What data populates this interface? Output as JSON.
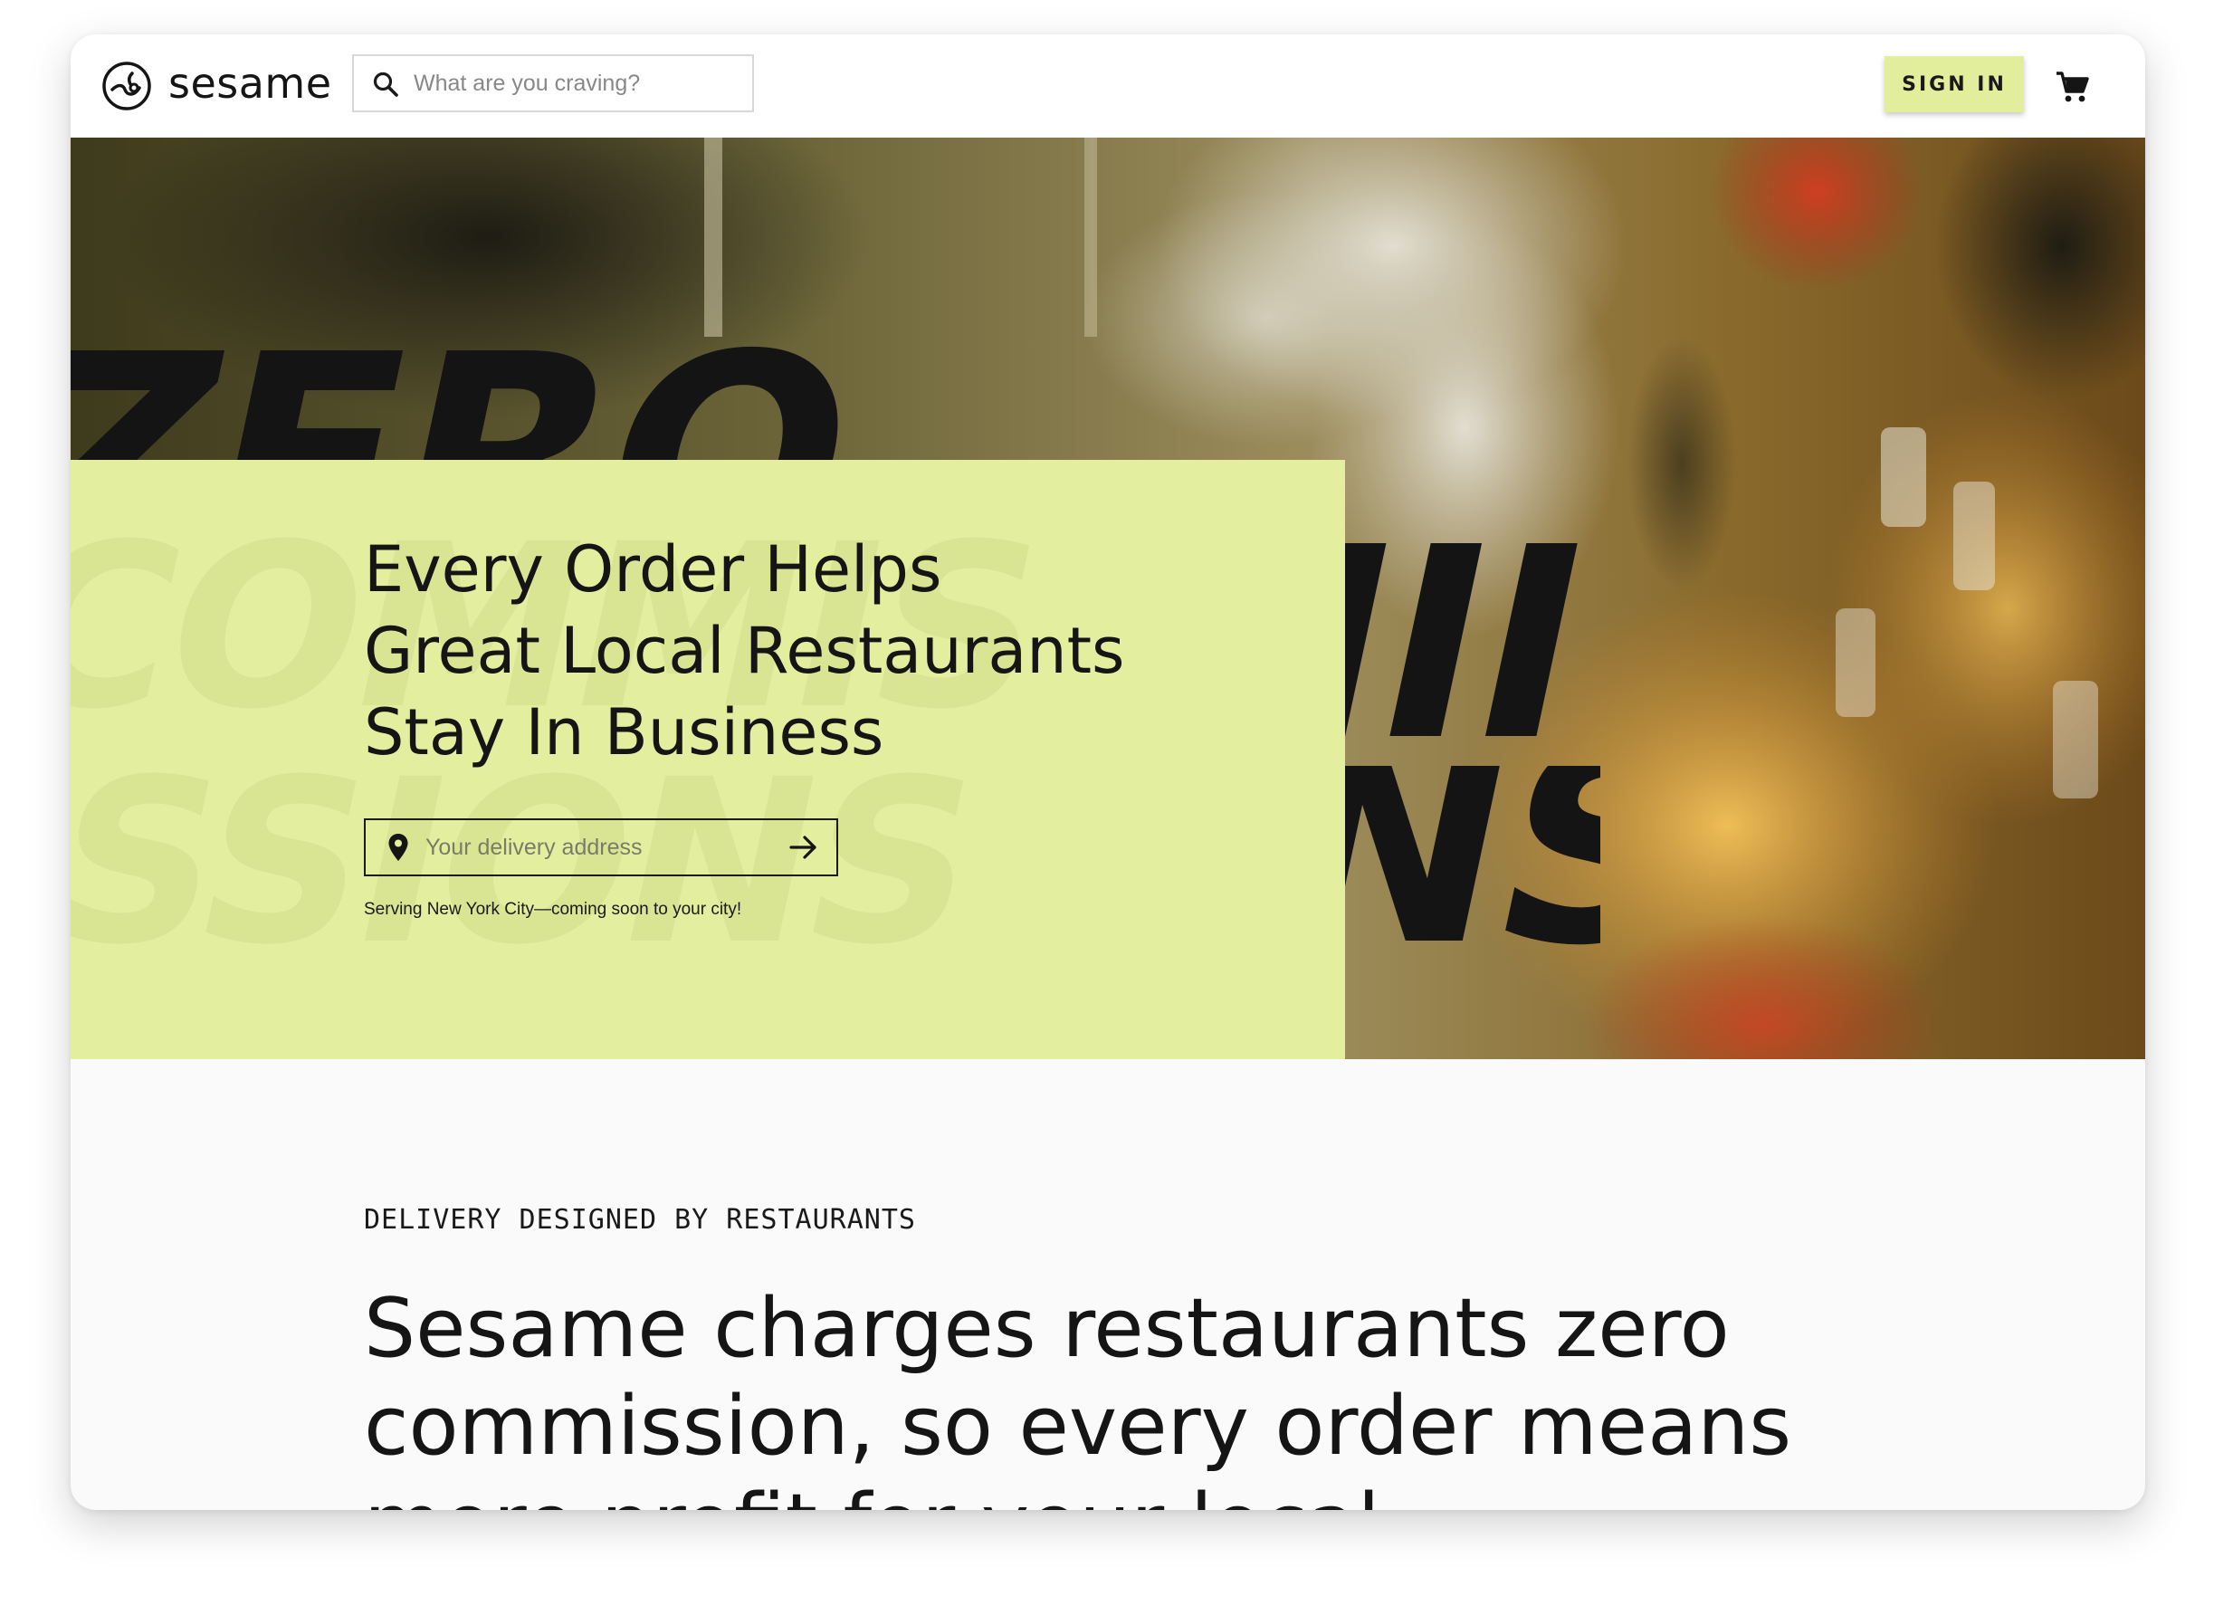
{
  "header": {
    "brand": "sesame",
    "search_placeholder": "What are you craving?",
    "signin_label": "SIGN IN",
    "icons": {
      "logo": "sesame-logo-icon",
      "search": "search-icon",
      "cart": "cart-icon"
    }
  },
  "hero": {
    "big_words": {
      "zero": "ZERO",
      "ghost_1": "COMMIS",
      "ghost_2": "SSIONS",
      "right_1": "III",
      "right_2": "NS"
    },
    "headline_lines": [
      "Every Order Helps",
      "Great Local Restaurants",
      "Stay In Business"
    ],
    "address_placeholder": "Your delivery address",
    "serving_text": "Serving New York City—coming soon to your city!",
    "icons": {
      "pin": "location-pin-icon",
      "go": "arrow-right-icon"
    },
    "colors": {
      "accent": "#e3ee9f",
      "ink": "#141414"
    }
  },
  "section": {
    "eyebrow": "DELIVERY DESIGNED BY RESTAURANTS",
    "statement": "Sesame charges restaurants zero commission, so every order means more profit for your local restaurants."
  }
}
